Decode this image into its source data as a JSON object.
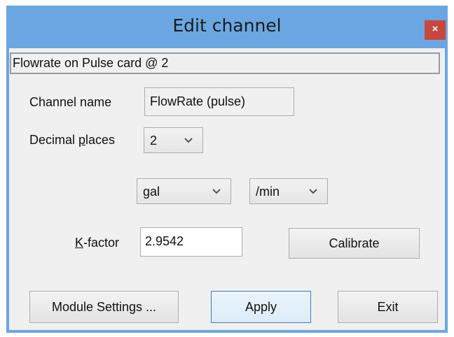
{
  "window": {
    "title": "Edit channel",
    "close_label": "×"
  },
  "info": {
    "text": "Flowrate on Pulse card @ 2"
  },
  "channel_name": {
    "label": "Channel name",
    "value": "FlowRate (pulse)"
  },
  "decimal_places": {
    "label_before": "Decimal ",
    "label_accel": "p",
    "label_after": "laces",
    "value": "2"
  },
  "units": {
    "volume": "gal",
    "time": "/min"
  },
  "kfactor": {
    "label_accel": "K",
    "label_after": "-factor",
    "value": "2.9542"
  },
  "buttons": {
    "calibrate": "Calibrate",
    "module_settings": "Module Settings ...",
    "apply": "Apply",
    "exit": "Exit"
  },
  "colors": {
    "frame": "#6aa7e2",
    "close_button": "#c9463d",
    "client": "#f0f0f0"
  }
}
